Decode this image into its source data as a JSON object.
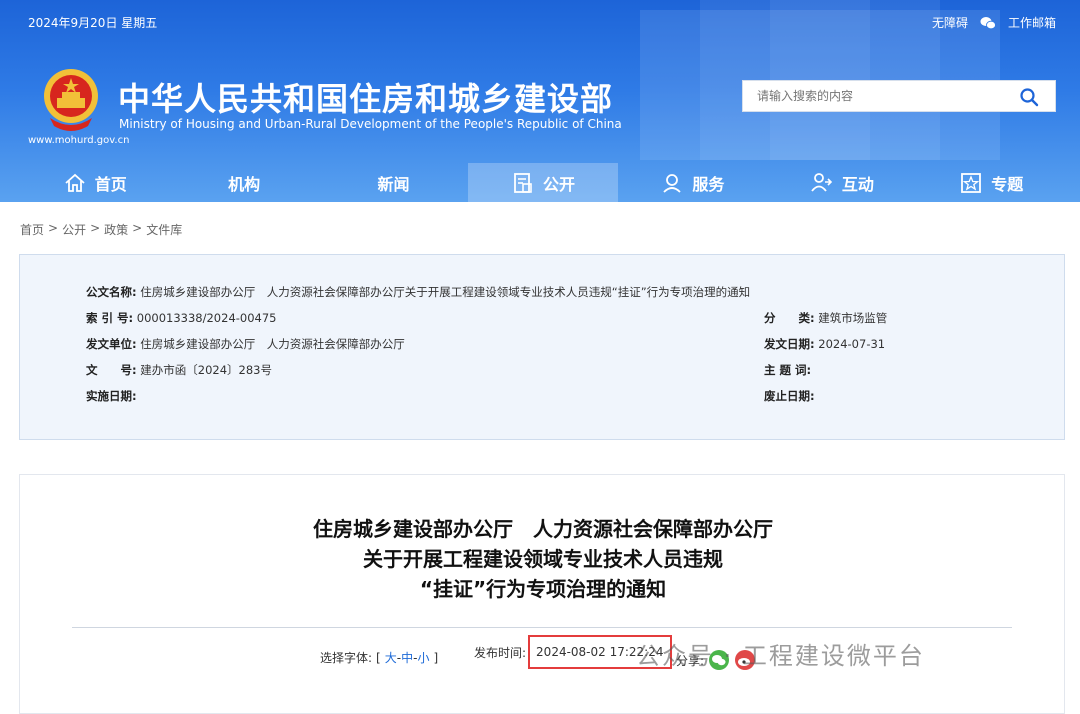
{
  "header": {
    "date": "2024年9月20日 星期五",
    "links": [
      "无障碍",
      "工作邮箱"
    ],
    "site_name": "中华人民共和国住房和城乡建设部",
    "site_name_en": "Ministry of Housing and Urban-Rural Development of the People's Republic of China",
    "domain": "www.mohurd.gov.cn",
    "search_placeholder": "请输入搜索的内容"
  },
  "nav": [
    {
      "label": "首页",
      "icon": "home-icon"
    },
    {
      "label": "机构",
      "icon": ""
    },
    {
      "label": "新闻",
      "icon": ""
    },
    {
      "label": "公开",
      "icon": "document-icon",
      "active": true
    },
    {
      "label": "服务",
      "icon": "service-icon"
    },
    {
      "label": "互动",
      "icon": "interaction-icon"
    },
    {
      "label": "专题",
      "icon": "star-icon"
    }
  ],
  "breadcrumb": [
    "首页",
    "公开",
    "政策",
    "文件库"
  ],
  "info": {
    "title_label": "公文名称:",
    "title_value": "住房城乡建设部办公厅　人力资源社会保障部办公厅关于开展工程建设领域专业技术人员违规“挂证”行为专项治理的通知",
    "index_label": "索 引 号:",
    "index_value": "000013338/2024-00475",
    "category_label": "分　　类:",
    "category_value": "建筑市场监管",
    "issuer_label": "发文单位:",
    "issuer_value": "住房城乡建设部办公厅　人力资源社会保障部办公厅",
    "issue_date_label": "发文日期:",
    "issue_date_value": "2024-07-31",
    "doc_no_label": "文　　号:",
    "doc_no_value": "建办市函〔2024〕283号",
    "keywords_label": "主 题 词:",
    "keywords_value": "",
    "effective_label": "实施日期:",
    "effective_value": "",
    "repeal_label": "废止日期:",
    "repeal_value": ""
  },
  "article": {
    "title_lines": [
      "住房城乡建设部办公厅　人力资源社会保障部办公厅",
      "关于开展工程建设领域专业技术人员违规",
      "“挂证”行为专项治理的通知"
    ],
    "font_label": "选择字体:",
    "font_sizes": [
      "大",
      "中",
      "小"
    ],
    "publish_label": "发布时间:",
    "publish_time": "2024-08-02 17:22:24",
    "share_label": "分享:",
    "watermark": "公众号 · 工程建设微平台"
  },
  "colors": {
    "header_blue": "#2f7be6",
    "highlight_red": "#e43c3c",
    "link_blue": "#1d6ad7"
  }
}
